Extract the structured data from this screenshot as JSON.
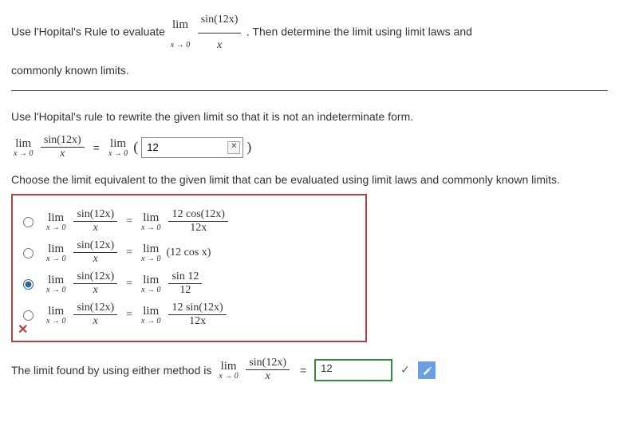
{
  "prompt": {
    "p1a": "Use l'Hopital's Rule to evaluate",
    "p1b": ". Then determine the limit using limit laws and",
    "p2": "commonly known limits."
  },
  "lim_notation": {
    "top": "lim",
    "bot": "x → 0"
  },
  "main_expr": {
    "num": "sin(12x)",
    "den": "x"
  },
  "section1": "Use l'Hopital's rule to rewrite the given limit so that it is not an indeterminate form.",
  "input1_value": "12",
  "paren_open": "(",
  "paren_close": ")",
  "section2": "Choose the limit equivalent to the given limit that can be evaluated using limit laws and commonly known limits.",
  "choices": [
    {
      "id": "a",
      "checked": false,
      "rhs_type": "frac",
      "rhs_num": "12 cos(12x)",
      "rhs_den": "12x"
    },
    {
      "id": "b",
      "checked": false,
      "rhs_type": "inline",
      "rhs_text": "(12 cos x)"
    },
    {
      "id": "c",
      "checked": true,
      "rhs_type": "frac",
      "rhs_num": "sin 12",
      "rhs_den": "12"
    },
    {
      "id": "d",
      "checked": false,
      "rhs_type": "frac",
      "rhs_num": "12 sin(12x)",
      "rhs_den": "12x"
    }
  ],
  "wrong_marker": "✕",
  "final_text": "The limit found by using either method is",
  "final_value": "12",
  "equals": "="
}
